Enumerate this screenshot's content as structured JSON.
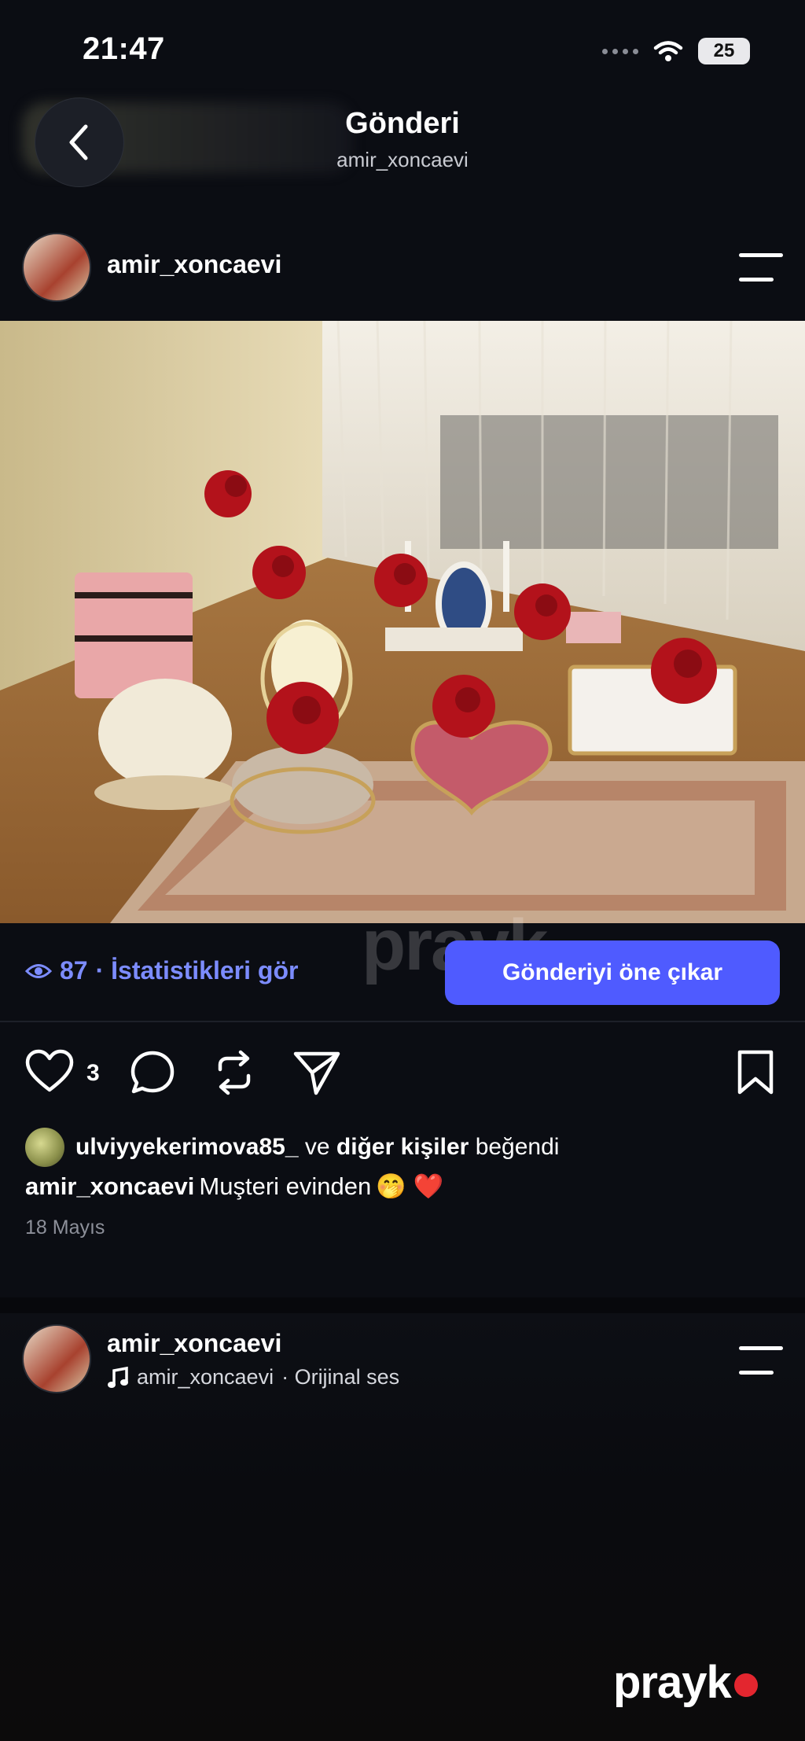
{
  "status_bar": {
    "time": "21:47",
    "battery": "25"
  },
  "header": {
    "title": "Gönderi",
    "subtitle": "amir_xoncaevi"
  },
  "post": {
    "username": "amir_xoncaevi",
    "views": "87",
    "stats_label": "· İstatistikleri gör",
    "boost_label": "Gönderiyi öne çıkar",
    "like_count": "3",
    "liked_by_user": "ulviyyekerimova85_",
    "liked_by_connector": "ve",
    "liked_by_others": "diğer kişiler",
    "liked_by_suffix": "beğendi",
    "caption_user": "amir_xoncaevi",
    "caption_text": "Muşteri evinden",
    "caption_emoji": "🤭 ❤️",
    "date": "18 Mayıs"
  },
  "second_post": {
    "username": "amir_xoncaevi",
    "audio_user": "amir_xoncaevi",
    "audio_label": "· Orijinal ses"
  },
  "watermark": {
    "center": "prayk",
    "logo": "prayk"
  },
  "colors": {
    "background": "#0b0d13",
    "accent": "#4f5bff",
    "stats_text": "#7c8cff",
    "logo_dot": "#e3262f"
  }
}
